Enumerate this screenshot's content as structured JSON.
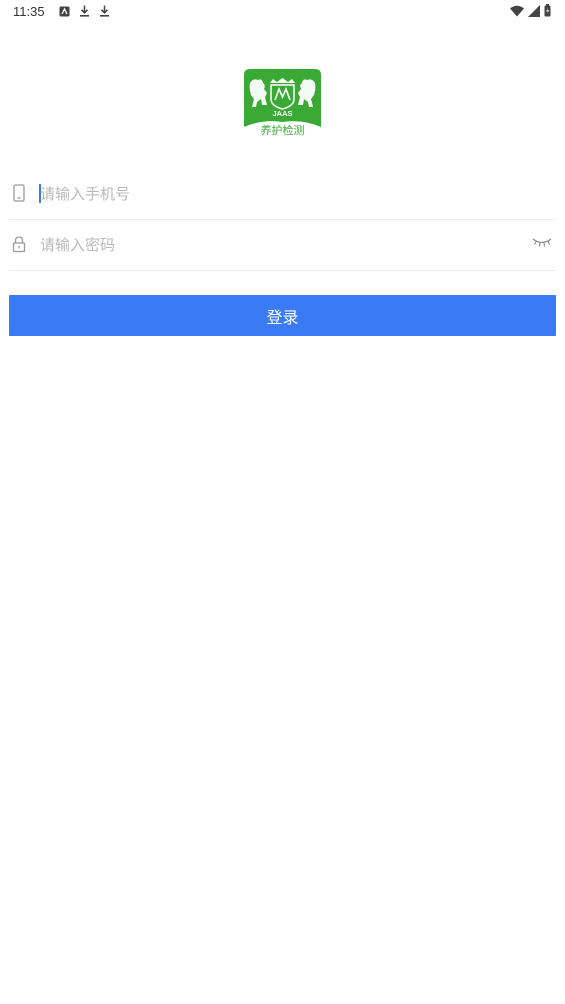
{
  "status_bar": {
    "time": "11:35",
    "left_icons": [
      "keyboard-icon",
      "download-icon",
      "download-icon"
    ],
    "right_icons": [
      "wifi-icon",
      "signal-icon",
      "battery-icon"
    ]
  },
  "logo": {
    "emblem_text": "JAAS",
    "caption": "养护检测",
    "color": "#3aa935"
  },
  "form": {
    "phone": {
      "icon": "phone-icon",
      "placeholder": "请输入手机号",
      "value": ""
    },
    "password": {
      "icon": "lock-icon",
      "placeholder": "请输入密码",
      "value": "",
      "toggle_icon": "eye-closed-icon"
    },
    "login_label": "登录"
  },
  "colors": {
    "accent": "#3a7af5",
    "placeholder": "#b9b9b9",
    "divider": "#ececec"
  }
}
